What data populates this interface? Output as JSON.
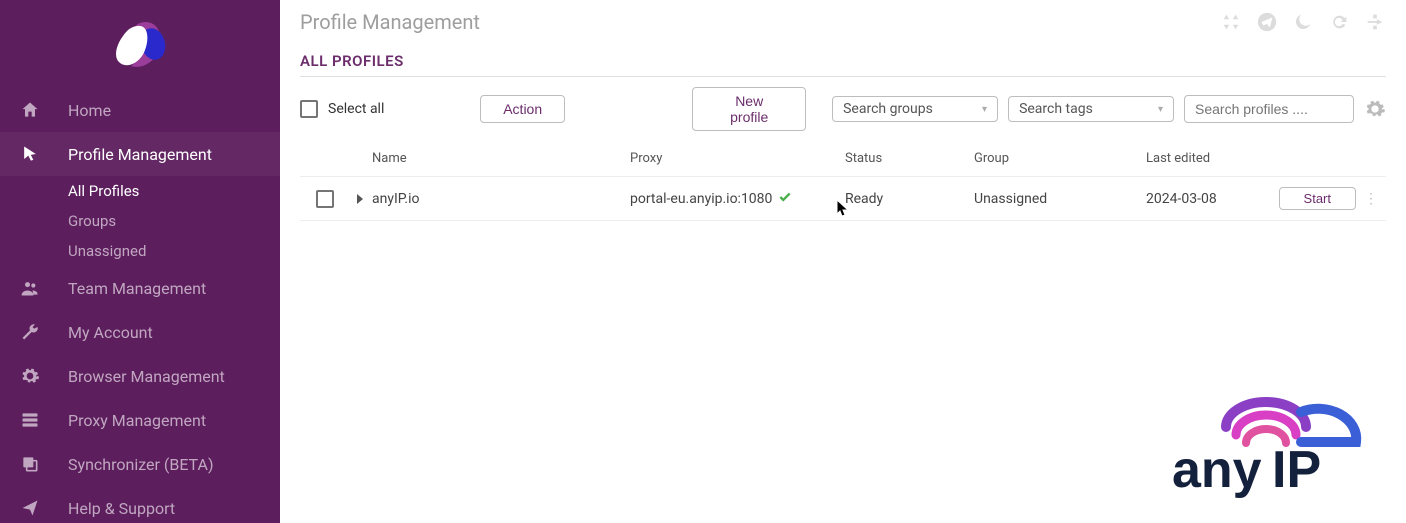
{
  "sidebar": {
    "items": [
      {
        "label": "Home"
      },
      {
        "label": "Profile Management"
      },
      {
        "label": "Team Management"
      },
      {
        "label": "My Account"
      },
      {
        "label": "Browser Management"
      },
      {
        "label": "Proxy Management"
      },
      {
        "label": "Synchronizer (BETA)"
      },
      {
        "label": "Help & Support"
      }
    ],
    "sub_items": [
      {
        "label": "All Profiles"
      },
      {
        "label": "Groups"
      },
      {
        "label": "Unassigned"
      }
    ]
  },
  "page": {
    "title": "Profile Management",
    "section": "ALL PROFILES"
  },
  "toolbar": {
    "select_all": "Select all",
    "action": "Action",
    "new_profile": "New profile",
    "search_groups": "Search groups",
    "search_tags": "Search tags",
    "search_profiles_placeholder": "Search profiles ...."
  },
  "table": {
    "headers": {
      "name": "Name",
      "proxy": "Proxy",
      "status": "Status",
      "group": "Group",
      "last_edited": "Last edited"
    },
    "rows": [
      {
        "name": "anyIP.io",
        "proxy": "portal-eu.anyip.io:1080",
        "status": "Ready",
        "group": "Unassigned",
        "last_edited": "2024-03-08",
        "action": "Start"
      }
    ]
  },
  "watermark": {
    "text": "anyIP"
  }
}
